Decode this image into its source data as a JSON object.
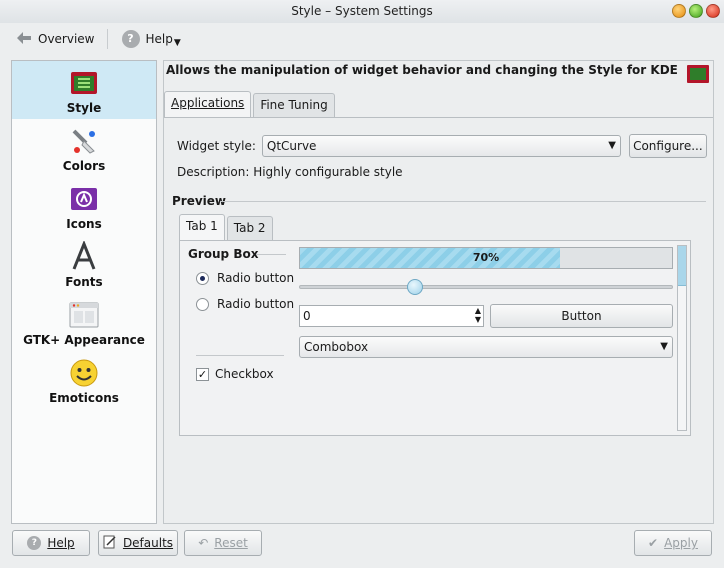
{
  "window": {
    "title": "Style – System Settings"
  },
  "toolbar": {
    "overview_label": "Overview",
    "help_label": "Help"
  },
  "sidebar": {
    "items": [
      {
        "label": "Style",
        "icon": "style-icon"
      },
      {
        "label": "Colors",
        "icon": "colors-icon"
      },
      {
        "label": "Icons",
        "icon": "icons-icon"
      },
      {
        "label": "Fonts",
        "icon": "fonts-icon"
      },
      {
        "label": "GTK+ Appearance",
        "icon": "gtk-appearance-icon"
      },
      {
        "label": "Emoticons",
        "icon": "emoticons-icon"
      }
    ]
  },
  "main": {
    "heading": "Allows the manipulation of widget behavior and changing the Style for KDE",
    "tabs": [
      {
        "label": "Applications"
      },
      {
        "label": "Fine Tuning"
      }
    ],
    "widget_style_label": "Widget style:",
    "widget_style_value": "QtCurve",
    "configure_label": "Configure...",
    "description": "Description: Highly configurable style",
    "preview_label": "Preview",
    "preview": {
      "tabs": [
        {
          "label": "Tab 1"
        },
        {
          "label": "Tab 2"
        }
      ],
      "group_box_title": "Group Box",
      "radio_1": "Radio button",
      "radio_2": "Radio button",
      "checkbox_label": "Checkbox",
      "checkbox_checked": true,
      "progress_text": "70%",
      "progress_value": 0.7,
      "slider_value": 0.31,
      "spin_value": "0",
      "button_label": "Button",
      "combobox_value": "Combobox"
    }
  },
  "footer": {
    "help_label": "Help",
    "defaults_label": "Defaults",
    "reset_label": "Reset",
    "apply_label": "Apply"
  },
  "colors": {
    "selection": "#cfe9f5",
    "accent": "#8dcfe8"
  }
}
